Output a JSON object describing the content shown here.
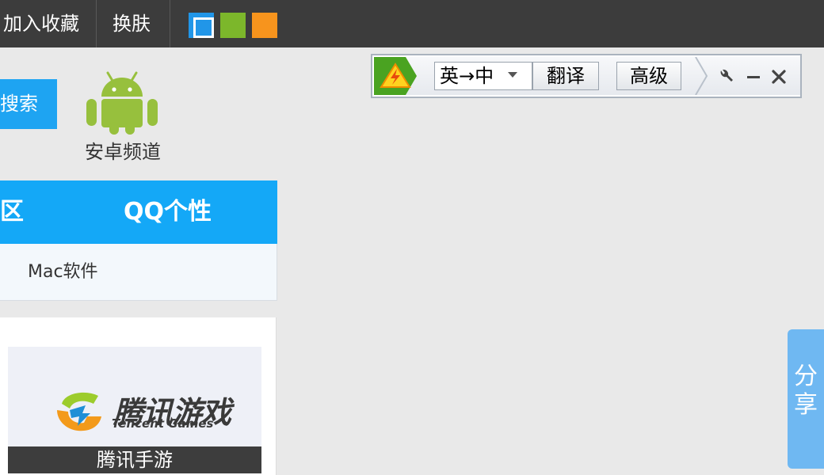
{
  "topbar": {
    "add_favorite": "加入收藏",
    "skin": "换肤",
    "skin_colors": [
      "#2196e8",
      "#7cb72b",
      "#f7941d"
    ]
  },
  "search": {
    "label": "搜索"
  },
  "android": {
    "label": "安卓频道",
    "icon": "android-icon",
    "color": "#97c03d"
  },
  "nav": {
    "tab_left": "区",
    "tab_qq": "QQ个性",
    "sub_link": "Mac软件",
    "accent": "#14a8f7"
  },
  "card": {
    "brand_cn": "腾讯游戏",
    "brand_en": "Tencent Games",
    "caption": "腾讯手游"
  },
  "translator": {
    "lang": "英→中",
    "translate_label": "翻译",
    "advanced_label": "高级",
    "icons": [
      "lightning-logo-icon",
      "wrench-icon",
      "minimize-icon",
      "close-icon"
    ]
  },
  "share": {
    "label": "分享"
  }
}
